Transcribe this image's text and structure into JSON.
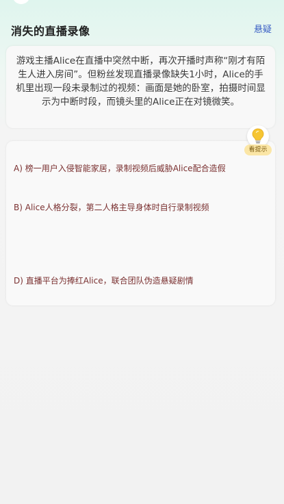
{
  "header": {
    "title": "消失的直播录像",
    "genre": "悬疑"
  },
  "story": {
    "text": "游戏主播Alice在直播中突然中断，再次开播时声称“刚才有陌生人进入房间”。但粉丝发现直播录像缺失1小时，Alice的手机里出现一段未录制过的视频：画面是她的卧室，拍摄时间显示为中断时段，而镜头里的Alice正在对镜微笑。"
  },
  "hint": {
    "label": "看提示",
    "icon": "lightbulb-icon"
  },
  "options": [
    {
      "text": "A) 榜一用户入侵智能家居，录制视频后威胁Alice配合造假"
    },
    {
      "text": "B) Alice人格分裂，第二人格主导身体时自行录制视频"
    },
    {
      "text": "D) 直播平台为捧红Alice，联合团队伪造悬疑剧情"
    }
  ],
  "colors": {
    "genre": "#3a5fc4",
    "option_text": "#7a3030",
    "hint_badge": "#fbe6a6",
    "bulb": "#f6c533"
  }
}
